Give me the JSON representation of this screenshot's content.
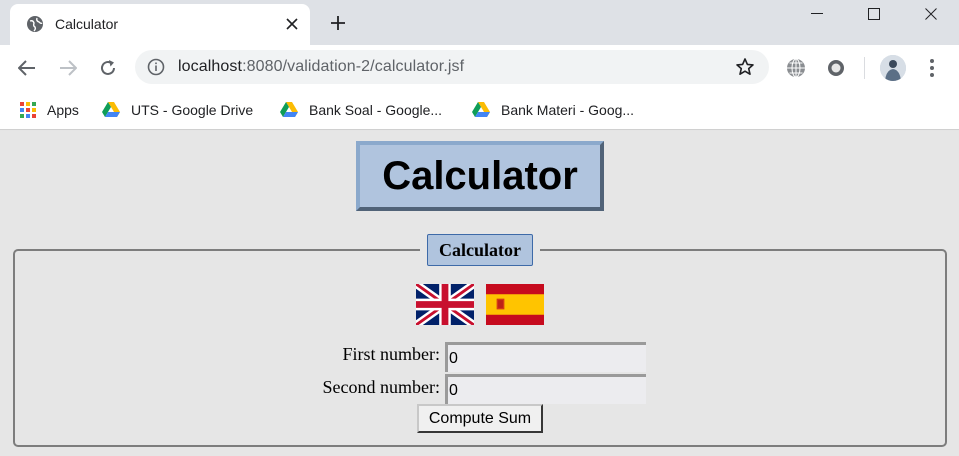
{
  "browser": {
    "tab": {
      "title": "Calculator"
    },
    "address": {
      "host": "localhost",
      "path": ":8080/validation-2/calculator.jsf"
    },
    "bookmarks": [
      {
        "label": "Apps",
        "icon": "apps-grid-icon"
      },
      {
        "label": "UTS - Google Drive",
        "icon": "google-drive-icon"
      },
      {
        "label": "Bank Soal - Google...",
        "icon": "google-drive-icon"
      },
      {
        "label": "Bank Materi - Goog...",
        "icon": "google-drive-icon"
      }
    ]
  },
  "page": {
    "heading": "Calculator",
    "form": {
      "legend": "Calculator",
      "languages": [
        "english-flag-icon",
        "spanish-flag-icon"
      ],
      "first_label": "First number:",
      "first_value": "0",
      "second_label": "Second number:",
      "second_value": "0",
      "submit_label": "Compute Sum"
    }
  },
  "colors": {
    "heading_bg": "#b0c4de",
    "page_bg": "#e6e6e6",
    "tabbar_bg": "#dee1e6"
  }
}
